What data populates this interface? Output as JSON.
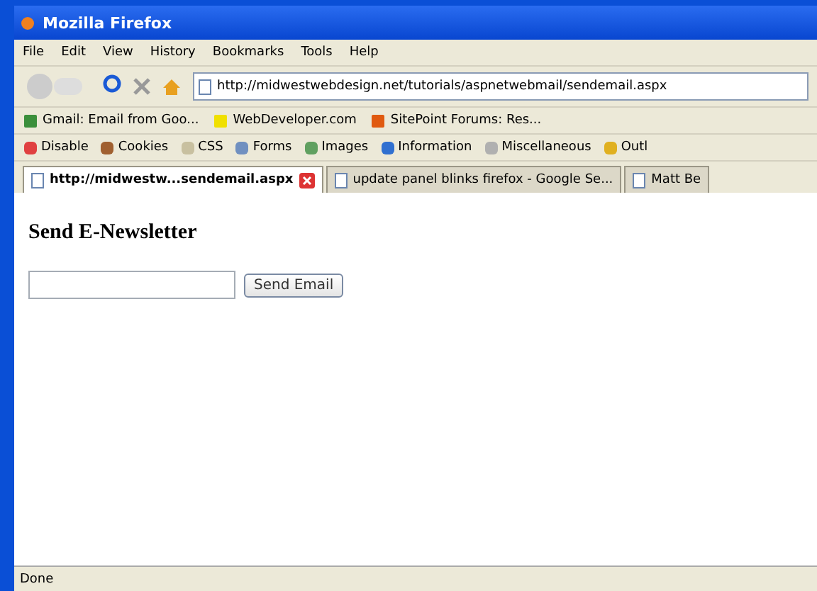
{
  "window": {
    "title": "Mozilla Firefox"
  },
  "menu": [
    "File",
    "Edit",
    "View",
    "History",
    "Bookmarks",
    "Tools",
    "Help"
  ],
  "address": {
    "url": "http://midwestwebdesign.net/tutorials/aspnetwebmail/sendemail.aspx"
  },
  "bookmarks": [
    {
      "label": "Gmail: Email from Goo...",
      "kind": "gmail"
    },
    {
      "label": "WebDeveloper.com",
      "kind": "wd"
    },
    {
      "label": "SitePoint Forums: Res...",
      "kind": "sitepoint"
    }
  ],
  "dev_toolbar": [
    "Disable",
    "Cookies",
    "CSS",
    "Forms",
    "Images",
    "Information",
    "Miscellaneous",
    "Outl"
  ],
  "tabs": [
    {
      "label": "http://midwestw...sendemail.aspx",
      "selected": true
    },
    {
      "label": "update panel blinks firefox - Google Se...",
      "selected": false
    },
    {
      "label": "Matt Be",
      "selected": false
    }
  ],
  "page": {
    "heading": "Send E-Newsletter",
    "button": "Send Email"
  },
  "status_bar": {
    "text": "Done"
  }
}
